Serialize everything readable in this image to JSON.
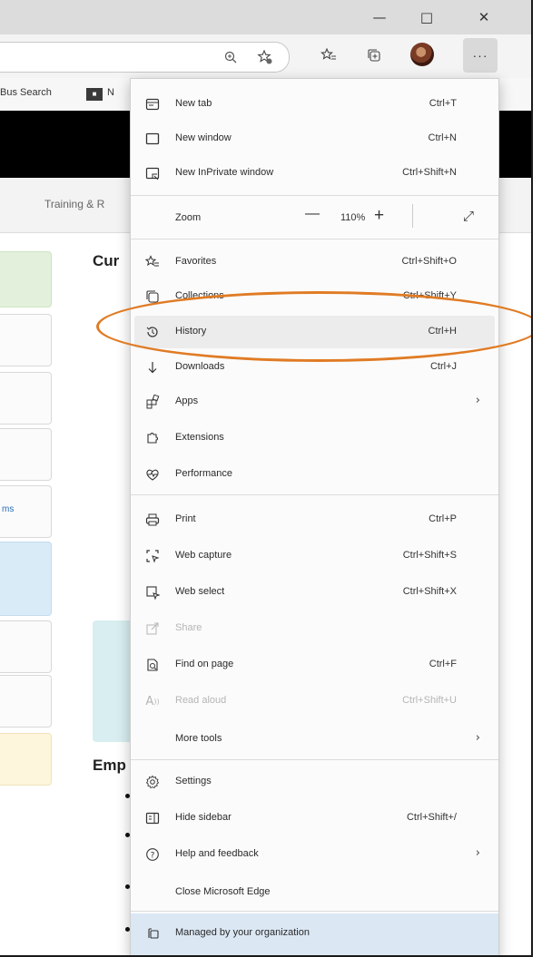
{
  "window": {
    "minimize_glyph": "—",
    "maximize_glyph": "□",
    "close_glyph": "✕"
  },
  "toolbar": {
    "zoom_icon": "zoom-in-icon",
    "more_label": "···"
  },
  "favorites_bar": {
    "items": [
      "Bus Search",
      "N"
    ]
  },
  "page": {
    "nav_text": "Training & R",
    "heading_1": "Cur",
    "heading_2": "Emp",
    "side_link_text": "ms"
  },
  "menu": {
    "new_tab": {
      "label": "New tab",
      "shortcut": "Ctrl+T",
      "icon": "new-tab-icon"
    },
    "new_window": {
      "label": "New window",
      "shortcut": "Ctrl+N",
      "icon": "window-icon"
    },
    "new_inprivate": {
      "label": "New InPrivate window",
      "shortcut": "Ctrl+Shift+N",
      "icon": "inprivate-icon"
    },
    "zoom": {
      "label": "Zoom",
      "minus": "—",
      "value": "110%",
      "plus": "+"
    },
    "favorites": {
      "label": "Favorites",
      "shortcut": "Ctrl+Shift+O",
      "icon": "favorites-icon"
    },
    "collections": {
      "label": "Collections",
      "shortcut": "Ctrl+Shift+Y",
      "icon": "collections-icon"
    },
    "history": {
      "label": "History",
      "shortcut": "Ctrl+H",
      "icon": "history-icon"
    },
    "downloads": {
      "label": "Downloads",
      "shortcut": "Ctrl+J",
      "icon": "download-icon"
    },
    "apps": {
      "label": "Apps",
      "icon": "apps-icon"
    },
    "extensions": {
      "label": "Extensions",
      "icon": "extensions-icon"
    },
    "performance": {
      "label": "Performance",
      "icon": "performance-icon"
    },
    "print": {
      "label": "Print",
      "shortcut": "Ctrl+P",
      "icon": "print-icon"
    },
    "web_capture": {
      "label": "Web capture",
      "shortcut": "Ctrl+Shift+S",
      "icon": "web-capture-icon"
    },
    "web_select": {
      "label": "Web select",
      "shortcut": "Ctrl+Shift+X",
      "icon": "web-select-icon"
    },
    "share": {
      "label": "Share",
      "icon": "share-icon"
    },
    "find_on_page": {
      "label": "Find on page",
      "shortcut": "Ctrl+F",
      "icon": "find-icon"
    },
    "read_aloud": {
      "label": "Read aloud",
      "shortcut": "Ctrl+Shift+U",
      "icon": "read-aloud-icon"
    },
    "more_tools": {
      "label": "More tools"
    },
    "settings": {
      "label": "Settings",
      "icon": "settings-icon"
    },
    "hide_sidebar": {
      "label": "Hide sidebar",
      "shortcut": "Ctrl+Shift+/",
      "icon": "sidebar-icon"
    },
    "help": {
      "label": "Help and feedback",
      "icon": "help-icon"
    },
    "close_edge": {
      "label": "Close Microsoft Edge"
    },
    "managed": {
      "label": "Managed by your organization",
      "icon": "managed-icon"
    }
  },
  "colors": {
    "highlight": "#e07b24",
    "managed_bg": "#dbe7f3"
  }
}
